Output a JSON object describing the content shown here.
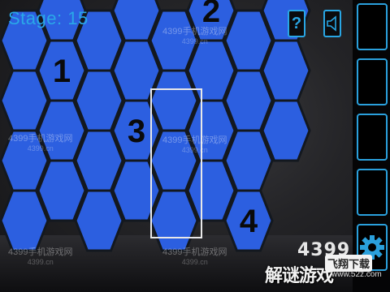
{
  "hud": {
    "stage_label": "Stage: 15",
    "help_label": "?",
    "help_icon": "question-icon",
    "sound_icon": "speaker-icon"
  },
  "colors": {
    "hex_fill": "#2c5fe0",
    "hex_edge": "#13181f",
    "selection": "#e8e8e8",
    "accent": "#29a6e4"
  },
  "tiles": {
    "numbers": [
      "1",
      "2",
      "3",
      "4"
    ]
  },
  "watermark": {
    "cn": "4399手机游戏网",
    "url": "4399.cn"
  },
  "brand": {
    "number": "4399",
    "name": "解谜游戏",
    "badge": "飞翔下载",
    "url": "www.52z.com"
  },
  "side_panel": {
    "settings_icon": "gear-icon"
  }
}
